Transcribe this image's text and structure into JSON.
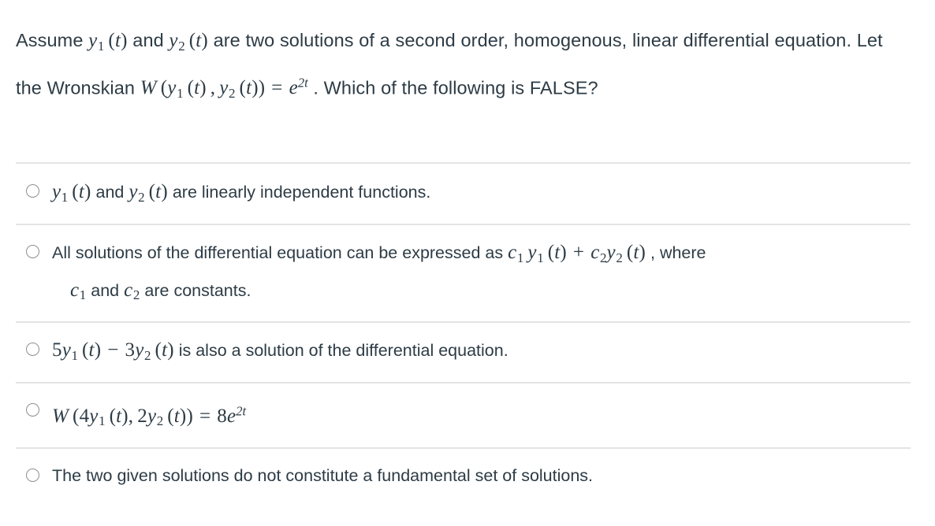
{
  "question": {
    "stem_parts": [
      {
        "type": "text",
        "value": "Assume "
      },
      {
        "type": "math",
        "value": "y1 (t)"
      },
      {
        "type": "text",
        "value": " and "
      },
      {
        "type": "math",
        "value": "y2 (t)"
      },
      {
        "type": "text",
        "value": " are two solutions of a second order, homogenous, linear differential equation. Let the Wronskian "
      },
      {
        "type": "math",
        "value": "W (y1 (t) , y2 (t)) = e^{2t}"
      },
      {
        "type": "text",
        "value": " . Which of the following is FALSE?"
      }
    ],
    "stem_plain": "Assume y1 (t) and y2 (t) are two solutions of a second order, homogenous, linear differential equation. Let the Wronskian W (y1 (t) , y2 (t)) = e^{2t} . Which of the following is FALSE?",
    "stem_line1_prefix": "Assume ",
    "stem_line1_and": " and ",
    "stem_line1_tail": " are two solutions of a second order, homogenous,",
    "stem_line2_prefix": "linear differential equation. Let the Wronskian ",
    "stem_line2_tail": " . Which",
    "stem_line3": "of the following is FALSE?",
    "var_y1": "y",
    "var_y1_sub": "1",
    "var_t": "t",
    "var_y2": "y",
    "var_y2_sub": "2",
    "wronskian_W": "W",
    "wronskian_eq": "=",
    "wronskian_e": "e",
    "wronskian_exp": "2t"
  },
  "answers": [
    {
      "id": "option-1",
      "selected": false,
      "text_plain": "y1 (t) and y2 (t) are linearly independent functions.",
      "mid_text": " and ",
      "tail_text": " are linearly independent functions."
    },
    {
      "id": "option-2",
      "selected": false,
      "text_plain": "All solutions of the differential equation can be expressed as c1 y1 (t) + c2 y2 (t) , where c1 and c2 are constants.",
      "lead_text": "All solutions of the differential equation can be expressed as ",
      "tail_text": " , where",
      "line2_and": " and ",
      "line2_tail": " are constants.",
      "const_c": "c",
      "const_c1_sub": "1",
      "const_c2_sub": "2",
      "plus": "+"
    },
    {
      "id": "option-3",
      "selected": false,
      "text_plain": "5y1 (t) - 3y2 (t) is also a solution of the differential equation.",
      "coef1": "5",
      "minus": "−",
      "coef2": "3",
      "tail_text": " is also a solution of the differential equation."
    },
    {
      "id": "option-4",
      "selected": false,
      "text_plain": "W (4y1 (t) , 2y2 (t)) = 8e^{2t}",
      "W": "W",
      "coef1": "4",
      "coef2": "2",
      "eq": "=",
      "rhs_coef": "8",
      "rhs_e": "e",
      "rhs_exp": "2t"
    },
    {
      "id": "option-5",
      "selected": false,
      "text_plain": "The two given solutions do not constitute a fundamental set of solutions."
    }
  ],
  "colors": {
    "text": "#2d3b45",
    "divider": "#e4e4e4",
    "radio_border": "#8b8f93",
    "background": "#ffffff"
  }
}
